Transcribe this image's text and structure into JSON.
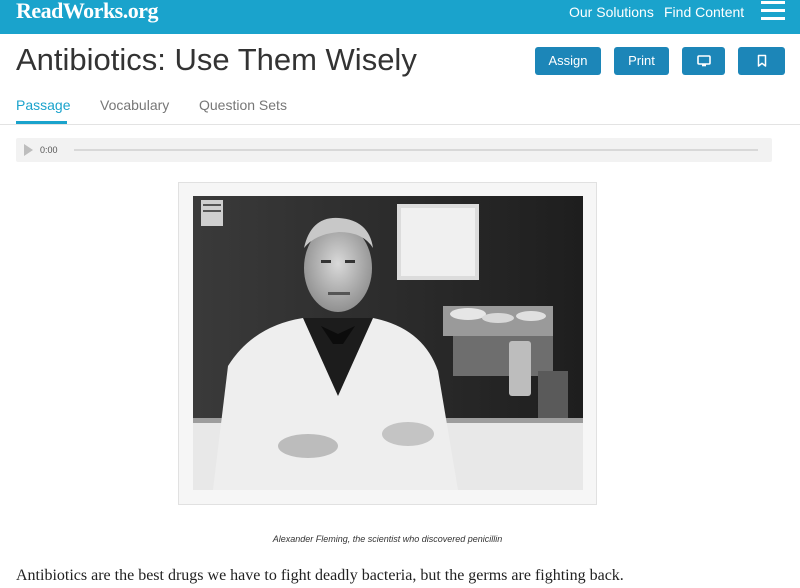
{
  "header": {
    "logo_text": "ReadWorks.org",
    "nav": [
      "Our Solutions",
      "Find Content"
    ],
    "menu_icon": "hamburger-icon"
  },
  "article": {
    "title": "Antibiotics: Use Them Wisely",
    "actions": {
      "assign": "Assign",
      "print": "Print",
      "monitor_icon": "monitor-icon",
      "bookmark_icon": "bookmark-icon"
    }
  },
  "tabs": [
    {
      "label": "Passage",
      "active": true
    },
    {
      "label": "Vocabulary",
      "active": false
    },
    {
      "label": "Question Sets",
      "active": false
    }
  ],
  "audio": {
    "time": "0:00",
    "progress": 0
  },
  "figure": {
    "image_description_icon": "photo-scientist",
    "caption": "Alexander Fleming, the scientist who discovered penicillin"
  },
  "passage": {
    "first_line": "Antibiotics are the best drugs we have to fight deadly bacteria, but the germs are fighting back."
  },
  "colors": {
    "brand": "#1aa3cc",
    "button": "#1c86b8",
    "text": "#333333"
  }
}
